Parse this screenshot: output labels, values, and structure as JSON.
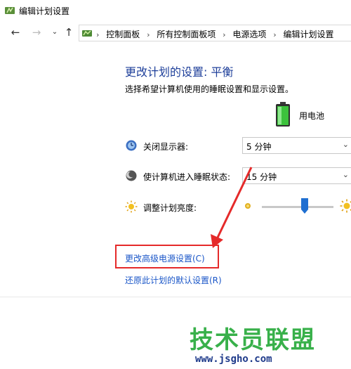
{
  "window": {
    "title": "编辑计划设置"
  },
  "nav": {
    "breadcrumbs": [
      "控制面板",
      "所有控制面板项",
      "电源选项",
      "编辑计划设置"
    ]
  },
  "main": {
    "title": "更改计划的设置: 平衡",
    "subtitle": "选择希望计算机使用的睡眠设置和显示设置。",
    "column_header": "用电池",
    "settings": [
      {
        "label": "关闭显示器:",
        "value": "5 分钟",
        "icon": "monitor-icon"
      },
      {
        "label": "使计算机进入睡眠状态:",
        "value": "15 分钟",
        "icon": "moon-icon"
      }
    ],
    "brightness": {
      "label": "调整计划亮度:",
      "level_percent": 60
    },
    "links": {
      "advanced": "更改高级电源设置(C)",
      "restore": "还原此计划的默认设置(R)"
    }
  },
  "watermark": {
    "text_main": "技术员联盟",
    "url": "www.jsgho.com"
  },
  "colors": {
    "title_blue": "#1e3f9a",
    "link_blue": "#1a56c8",
    "annotation_red": "#e52a2a",
    "watermark_green": "#38b04a"
  }
}
